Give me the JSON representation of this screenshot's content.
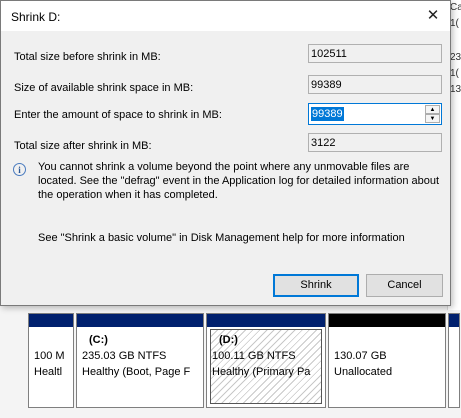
{
  "dialog": {
    "title": "Shrink D:",
    "close_glyph": "✕",
    "fields": [
      {
        "label": "Total size before shrink in MB:",
        "value": "102511"
      },
      {
        "label": "Size of available shrink space in MB:",
        "value": "99389"
      },
      {
        "label": "Enter the amount of space to shrink in MB:",
        "value": "99389"
      },
      {
        "label": "Total size after shrink in MB:",
        "value": "3122"
      }
    ],
    "info_text": "You cannot shrink a volume beyond the point where any unmovable files are located. See the \"defrag\" event in the Application log for detailed information about the operation when it has completed.",
    "help_text": "See \"Shrink a basic volume\" in Disk Management help for more information",
    "shrink_label": "Shrink",
    "cancel_label": "Cancel",
    "info_icon": "info-icon"
  },
  "background": {
    "right_col_chars": [
      "Ca",
      "1(",
      "23",
      "1(",
      "13"
    ],
    "partitions": [
      {
        "name": "",
        "size": "100 M",
        "status": "Healtl"
      },
      {
        "name": "(C:)",
        "size": "235.03 GB NTFS",
        "status": "Healthy (Boot, Page F"
      },
      {
        "name": "(D:)",
        "size": "100.11 GB NTFS",
        "status": "Healthy (Primary Pa"
      },
      {
        "name": "",
        "size": "130.07 GB",
        "status": "Unallocated"
      },
      {
        "name": "",
        "size": "",
        "status": ""
      }
    ],
    "colors": {
      "primary_bar": "#00206e",
      "unallocated_bar": "#000000",
      "accent": "#0078d7"
    }
  }
}
